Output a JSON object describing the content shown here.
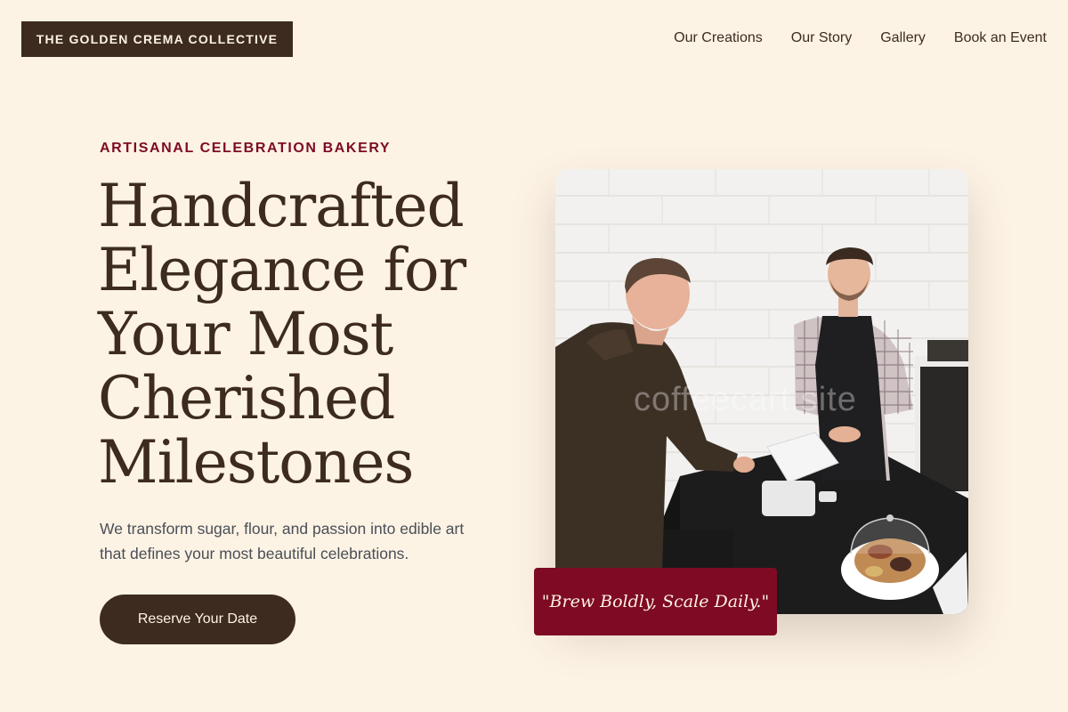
{
  "brand": {
    "name": "THE GOLDEN CREMA COLLECTIVE"
  },
  "nav": {
    "items": [
      {
        "label": "Our Creations"
      },
      {
        "label": "Our Story"
      },
      {
        "label": "Gallery"
      },
      {
        "label": "Book an Event"
      }
    ]
  },
  "hero": {
    "eyebrow": "ARTISANAL CELEBRATION BAKERY",
    "title": "Handcrafted Elegance for Your Most Cherished Milestones",
    "subtitle": "We transform sugar, flour, and passion into edible art that defines your most beautiful celebrations.",
    "cta_label": "Reserve Your Date",
    "quote": "\"Brew Boldly, Scale Daily.\"",
    "watermark": "coffeecart.site"
  },
  "colors": {
    "background": "#fdf3e4",
    "brand_dark": "#3d2b1f",
    "accent": "#7e0a24"
  }
}
